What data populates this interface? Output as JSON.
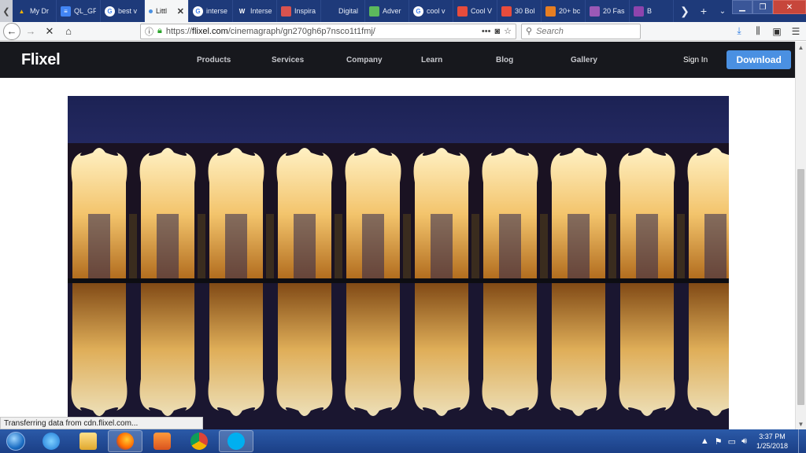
{
  "tabs": [
    {
      "title": "My Dr",
      "icon": "google-drive-icon",
      "color": "#f4b400"
    },
    {
      "title": "QL_GF",
      "icon": "google-docs-icon",
      "color": "#4285f4"
    },
    {
      "title": "best v",
      "icon": "google-icon",
      "color": "#ffffff"
    },
    {
      "title": "Littl",
      "icon": "loading-dot-icon",
      "color": "#4a90e2",
      "active": true
    },
    {
      "title": "interse",
      "icon": "google-icon",
      "color": "#ffffff"
    },
    {
      "title": "Interse",
      "icon": "wikipedia-icon",
      "color": "#ffffff"
    },
    {
      "title": "Inspira",
      "icon": "site-icon",
      "color": "#d9534f"
    },
    {
      "title": "Digital",
      "icon": "site-icon",
      "color": "#1e3a7a"
    },
    {
      "title": "Adver",
      "icon": "site-icon",
      "color": "#5cb85c"
    },
    {
      "title": "cool v",
      "icon": "google-icon",
      "color": "#ffffff"
    },
    {
      "title": "Cool V",
      "icon": "site-icon",
      "color": "#e74c3c"
    },
    {
      "title": "30 Bol",
      "icon": "site-icon",
      "color": "#e74c3c"
    },
    {
      "title": "20+ bc",
      "icon": "site-icon",
      "color": "#e67e22"
    },
    {
      "title": "20 Fas",
      "icon": "site-icon",
      "color": "#9b59b6"
    },
    {
      "title": "B",
      "icon": "site-icon",
      "color": "#8e44ad"
    }
  ],
  "tab_glyphs": {
    "google": "G",
    "wiki": "W",
    "docs": "≡",
    "drive": "▲"
  },
  "nav": {
    "url_host": "flixel.com",
    "url_prefix": "https://",
    "url_path": "/cinemagraph/gn270gh6p7nsco1t1fmj/",
    "search_placeholder": "Search",
    "more_label": "•••"
  },
  "site": {
    "logo": "Flixel",
    "nav_items": [
      "Products",
      "Services",
      "Company",
      "Learn",
      "Blog",
      "Gallery"
    ],
    "signin": "Sign In",
    "download": "Download"
  },
  "status_text": "Transferring data from cdn.flixel.com...",
  "taskbar": {
    "time": "3:37 PM",
    "date": "1/25/2018"
  },
  "colors": {
    "accent": "#4a90e2",
    "header_bg": "#17181d"
  }
}
